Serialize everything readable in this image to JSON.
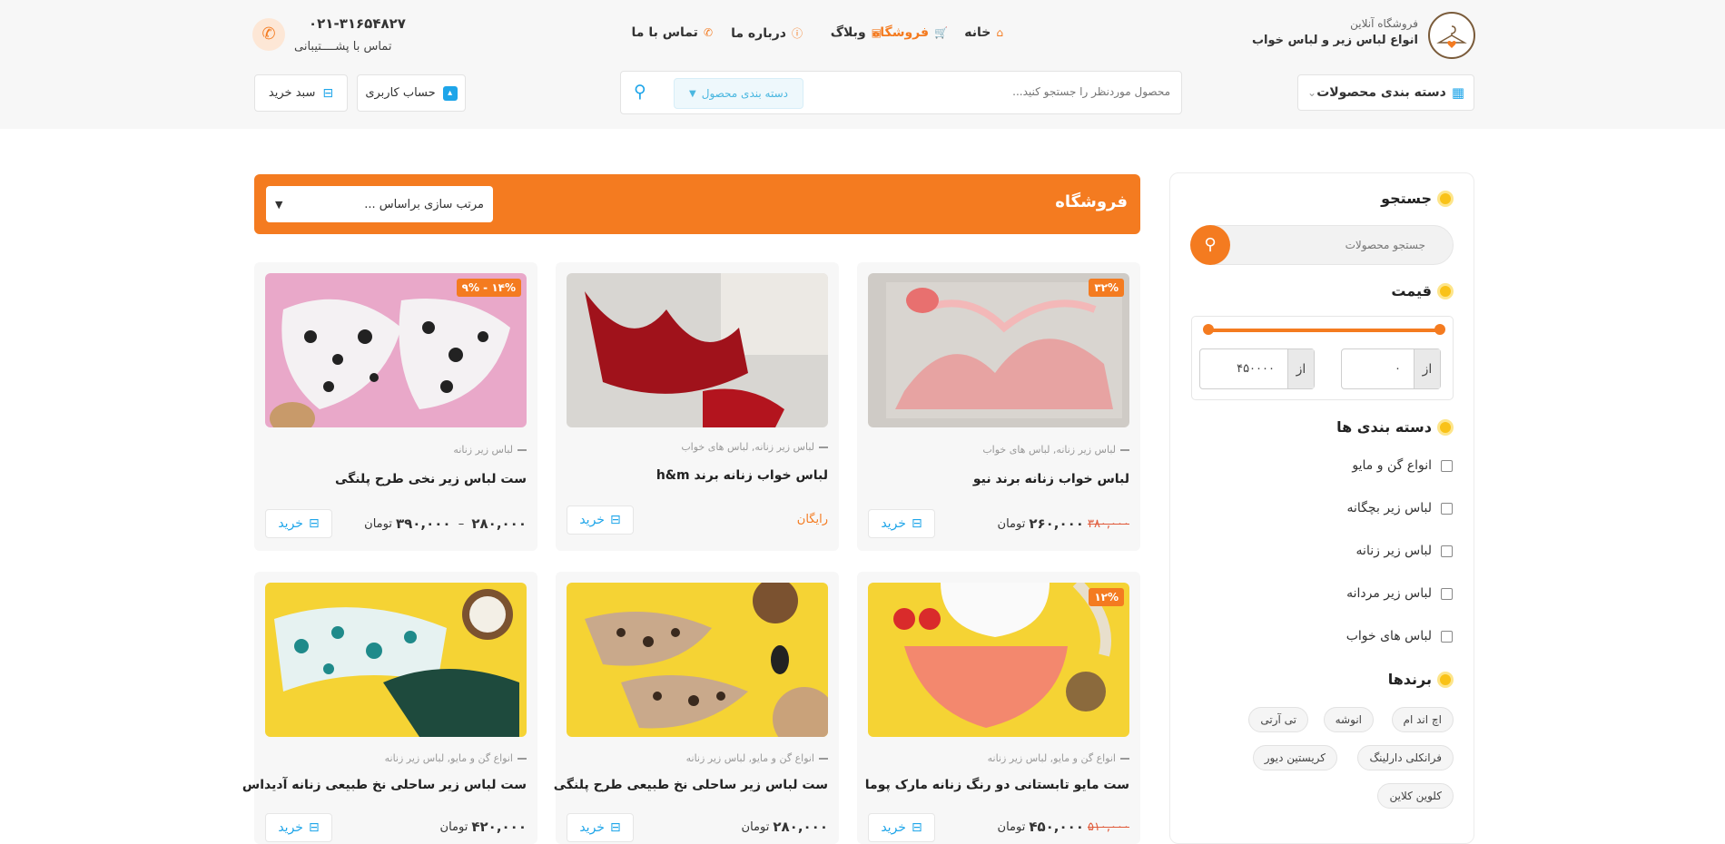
{
  "header": {
    "brand_line1": "فروشگاه آنلاین",
    "brand_line2": "انواع لباس زیر و لباس خواب",
    "nav": [
      {
        "label": "خانه",
        "icon": "home-icon"
      },
      {
        "label": "فروشگاه",
        "icon": "cart-icon",
        "active": true
      },
      {
        "label": "وبلاگ",
        "icon": "document-icon"
      },
      {
        "label": "درباره ما",
        "icon": "info-icon"
      },
      {
        "label": "تماس با ما",
        "icon": "phone-icon"
      }
    ],
    "phone_number": "۰۲۱-۳۱۶۵۴۸۲۷",
    "phone_caption": "تماس با پشــــتیبانی",
    "categories_button": "دسته بندی محصولات",
    "search_placeholder": "محصول موردنظر را جستجو کنید...",
    "search_category": "دسته بندی محصول",
    "account_button": "حساب کاربری",
    "cart_button": "سبد خرید"
  },
  "sidebar": {
    "search_title": "جستجو",
    "search_placeholder": "جستجو محصولات",
    "price_title": "قیمت",
    "price_from_label": "از",
    "price_min": "۰",
    "price_to_label": "از",
    "price_max": "۴۵۰۰۰۰",
    "categories_title": "دسته بندی ها",
    "categories": [
      "انواع گن و مایو",
      "لباس زیر بچگانه",
      "لباس زیر زنانه",
      "لباس زیر مردانه",
      "لباس های خواب"
    ],
    "brands_title": "برندها",
    "brands": [
      "اچ اند ام",
      "انوشه",
      "تی آرتی",
      "فرانکلی دارلینگ",
      "کریستین دیور",
      "کلوین کلاین"
    ]
  },
  "shop": {
    "title": "فروشگاه",
    "sort_placeholder": "مرتب سازی براساس ...",
    "buy_label": "خرید",
    "currency": "تومان",
    "products": [
      {
        "category": "لباس زیر زنانه, لباس های خواب",
        "name": "لباس خواب زنانه برند نیو",
        "badge": "۳۲%",
        "price": "۲۶۰,۰۰۰",
        "old_price": "۳۸۰,۰۰۰"
      },
      {
        "category": "لباس زیر زنانه, لباس های خواب",
        "name": "لباس خواب زنانه برند h&m",
        "badge": "",
        "free": "رایگان"
      },
      {
        "category": "لباس زیر زنانه",
        "name": "ست لباس زیر نخی طرح پلنگی",
        "badge": "۹% - ۱۴%",
        "price_low": "۲۸۰,۰۰۰",
        "price_high": "۳۹۰,۰۰۰"
      },
      {
        "category": "انواع گن و مایو, لباس زیر زنانه",
        "name": "ست مایو تابستانی دو رنگ زنانه مارک پوما",
        "badge": "۱۲%",
        "price": "۴۵۰,۰۰۰",
        "old_price": "۵۱۰,۰۰۰"
      },
      {
        "category": "انواع گن و مایو, لباس زیر زنانه",
        "name": "ست لباس زیر ساحلی نخ طبیعی طرح پلنگی",
        "badge": "",
        "price": "۲۸۰,۰۰۰"
      },
      {
        "category": "انواع گن و مایو, لباس زیر زنانه",
        "name": "ست لباس زیر ساحلی نخ طبیعی زنانه آدیداس",
        "badge": "",
        "price": "۴۲۰,۰۰۰"
      }
    ]
  }
}
